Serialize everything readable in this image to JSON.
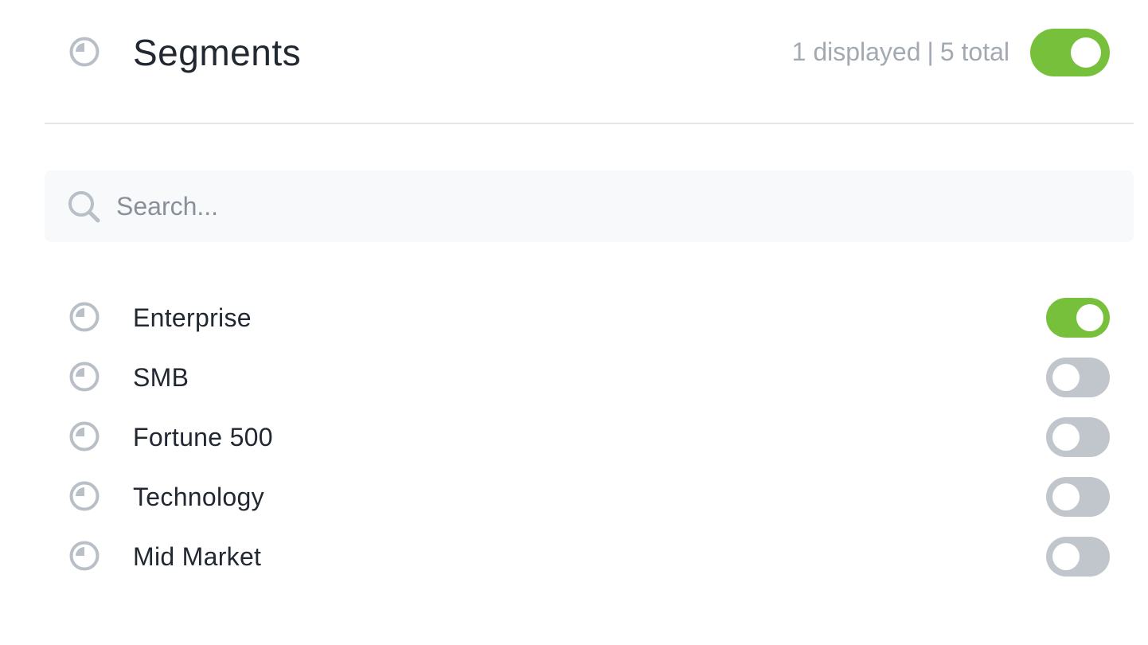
{
  "header": {
    "title": "Segments",
    "displayed_text": "1 displayed",
    "separator": "|",
    "total_text": "5 total",
    "toggle_on": true,
    "icon": "pie-segment-icon"
  },
  "search": {
    "placeholder": "Search...",
    "value": "",
    "icon": "search-icon"
  },
  "segments": [
    {
      "label": "Enterprise",
      "enabled": true
    },
    {
      "label": "SMB",
      "enabled": false
    },
    {
      "label": "Fortune 500",
      "enabled": false
    },
    {
      "label": "Technology",
      "enabled": false
    },
    {
      "label": "Mid Market",
      "enabled": false
    }
  ],
  "colors": {
    "toggle_on": "#77c03b",
    "toggle_off": "#c1c6cc",
    "icon": "#b9bfc6",
    "muted_text": "#a2a9b1",
    "text": "#222831"
  }
}
